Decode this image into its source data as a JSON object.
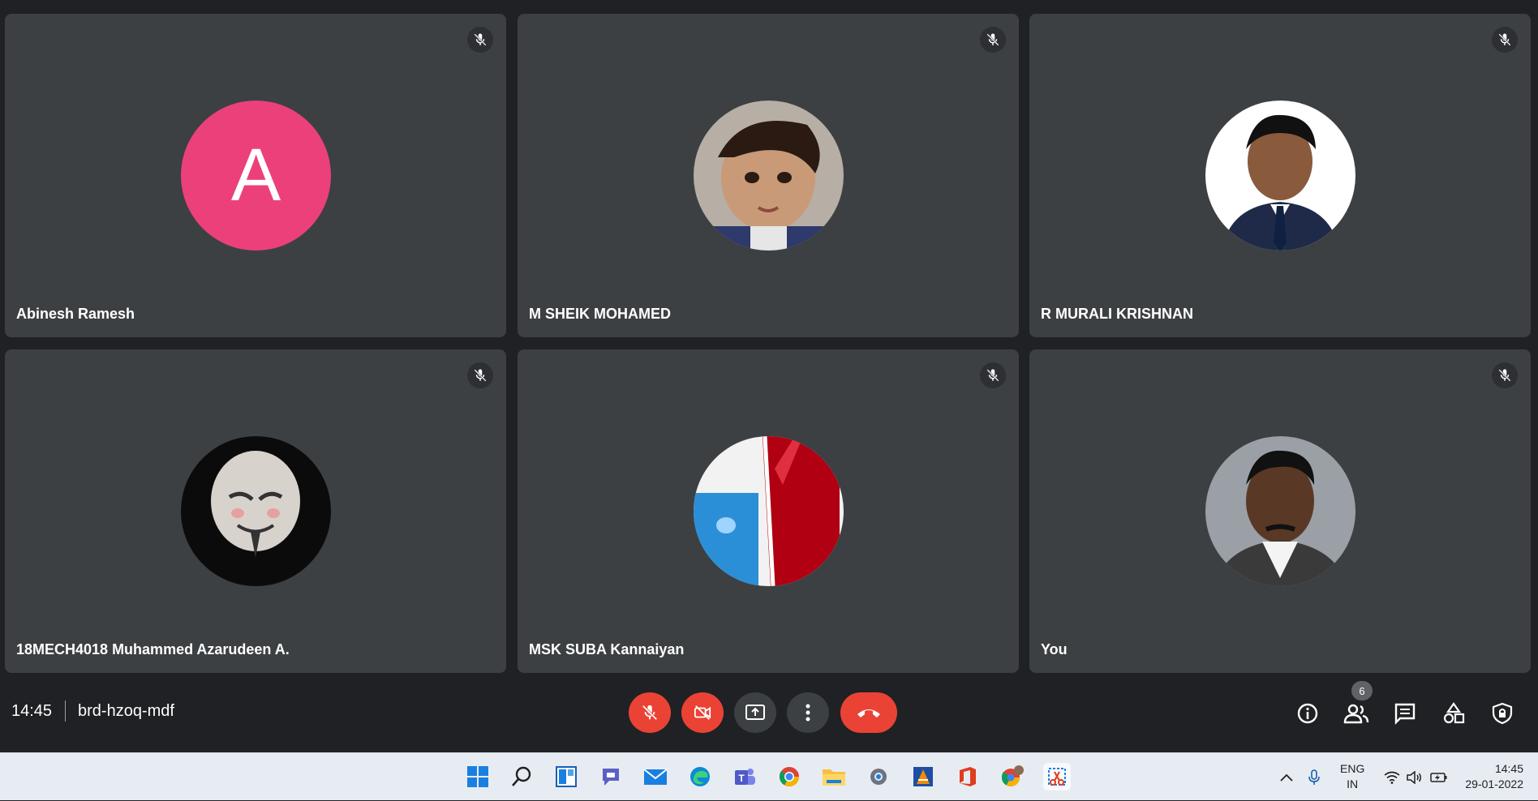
{
  "participants": [
    {
      "name": "Abinesh Ramesh",
      "avatar": "letter",
      "letter": "A"
    },
    {
      "name": "M SHEIK MOHAMED",
      "avatar": "photo-child"
    },
    {
      "name": "R MURALI KRISHNAN",
      "avatar": "photo-suit"
    },
    {
      "name": "18MECH4018 Muhammed Azarudeen A.",
      "avatar": "photo-mask"
    },
    {
      "name": "MSK SUBA Kannaiyan",
      "avatar": "photo-abstract"
    },
    {
      "name": "You",
      "avatar": "photo-man"
    }
  ],
  "meeting": {
    "time": "14:45",
    "code": "brd-hzoq-mdf",
    "people_count": "6"
  },
  "controls": {
    "mic": "mic-off-icon",
    "camera": "camera-off-icon",
    "present": "present-icon",
    "more": "more-vert-icon",
    "hangup": "call-end-icon"
  },
  "colors": {
    "tile_bg": "#3c4043",
    "page_bg": "#202124",
    "danger": "#ea4335",
    "avatar_pink": "#ec407a"
  },
  "taskbar": {
    "lang_top": "ENG",
    "lang_bottom": "IN",
    "time": "14:45",
    "date": "29-01-2022"
  }
}
